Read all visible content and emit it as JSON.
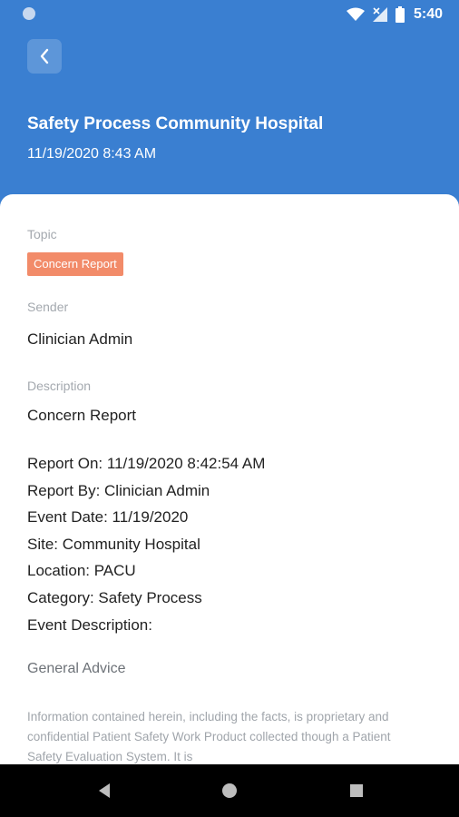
{
  "status_bar": {
    "time": "5:40"
  },
  "header": {
    "title": "Safety Process Community Hospital",
    "date": "11/19/2020 8:43 AM"
  },
  "topic": {
    "label": "Topic",
    "value": "Concern Report",
    "color": "#f28b69"
  },
  "sender": {
    "label": "Sender",
    "value": "Clinician Admin"
  },
  "description": {
    "label": "Description",
    "value": "Concern Report",
    "details": [
      "Report On: 11/19/2020 8:42:54 AM",
      "Report By: Clinician Admin",
      "Event Date: 11/19/2020",
      "Site: Community Hospital",
      "Location: PACU",
      "Category: Safety Process",
      "Event Description:"
    ]
  },
  "advice": {
    "title": "General Advice",
    "text": "Information contained herein, including the facts, is proprietary and confidential Patient Safety Work Product collected though a Patient Safety Evaluation System. It is"
  },
  "colors": {
    "header_bg": "#3a7fd1",
    "card_bg": "#ffffff",
    "nav_bg": "#000000"
  }
}
